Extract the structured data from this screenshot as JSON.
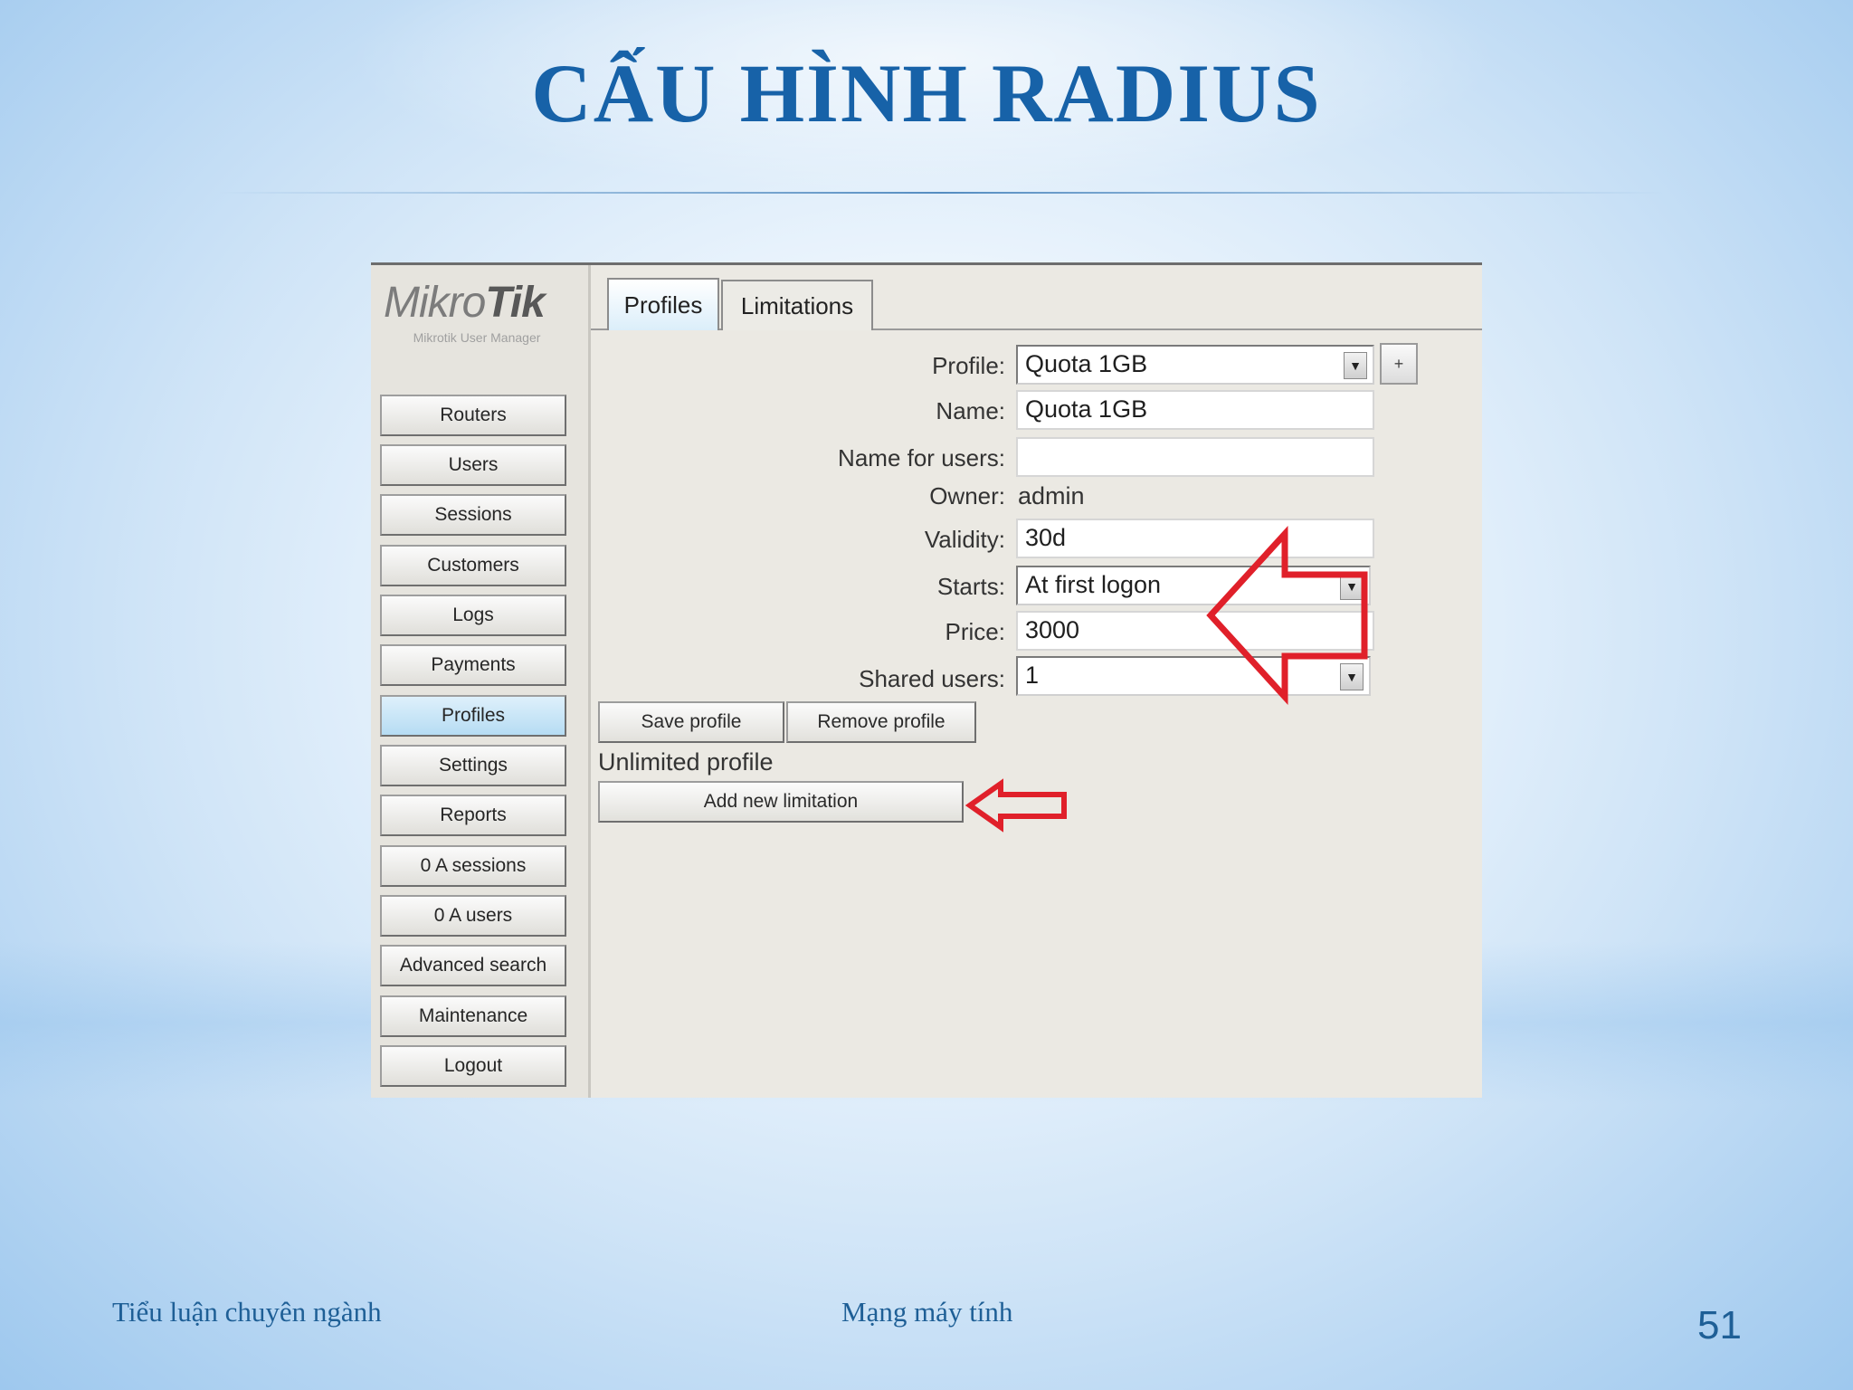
{
  "slide": {
    "title": "CẤU HÌNH RADIUS",
    "footer_left": "Tiểu luận chuyên ngành",
    "footer_center": "Mạng máy tính",
    "page_number": "51"
  },
  "app": {
    "logo_light": "Mikro",
    "logo_bold": "Tik",
    "logo_subtitle": "Mikrotik User Manager",
    "sidebar": [
      {
        "label": "Routers",
        "active": false
      },
      {
        "label": "Users",
        "active": false
      },
      {
        "label": "Sessions",
        "active": false
      },
      {
        "label": "Customers",
        "active": false
      },
      {
        "label": "Logs",
        "active": false
      },
      {
        "label": "Payments",
        "active": false
      },
      {
        "label": "Profiles",
        "active": true
      },
      {
        "label": "Settings",
        "active": false
      },
      {
        "label": "Reports",
        "active": false
      },
      {
        "label": "0 A sessions",
        "active": false
      },
      {
        "label": "0 A users",
        "active": false
      },
      {
        "label": "Advanced search",
        "active": false
      },
      {
        "label": "Maintenance",
        "active": false
      },
      {
        "label": "Logout",
        "active": false
      }
    ],
    "tabs": [
      {
        "label": "Profiles",
        "active": true
      },
      {
        "label": "Limitations",
        "active": false
      }
    ],
    "form": {
      "profile_label": "Profile:",
      "profile_value": "Quota 1GB",
      "plus_label": "+",
      "name_label": "Name:",
      "name_value": "Quota 1GB",
      "name_for_users_label": "Name for users:",
      "name_for_users_value": "",
      "owner_label": "Owner:",
      "owner_value": "admin",
      "validity_label": "Validity:",
      "validity_value": "30d",
      "starts_label": "Starts:",
      "starts_value": "At first logon",
      "price_label": "Price:",
      "price_value": "3000",
      "shared_users_label": "Shared users:",
      "shared_users_value": "1"
    },
    "buttons": {
      "save_profile": "Save profile",
      "remove_profile": "Remove profile",
      "add_new_limitation": "Add new limitation"
    },
    "unlimited_profile_text": "Unlimited profile",
    "dropdown_glyph": "▼"
  },
  "colors": {
    "title": "#1762a8",
    "annotation_arrow": "#e0202a",
    "active_tab": "#b6dcf3"
  }
}
